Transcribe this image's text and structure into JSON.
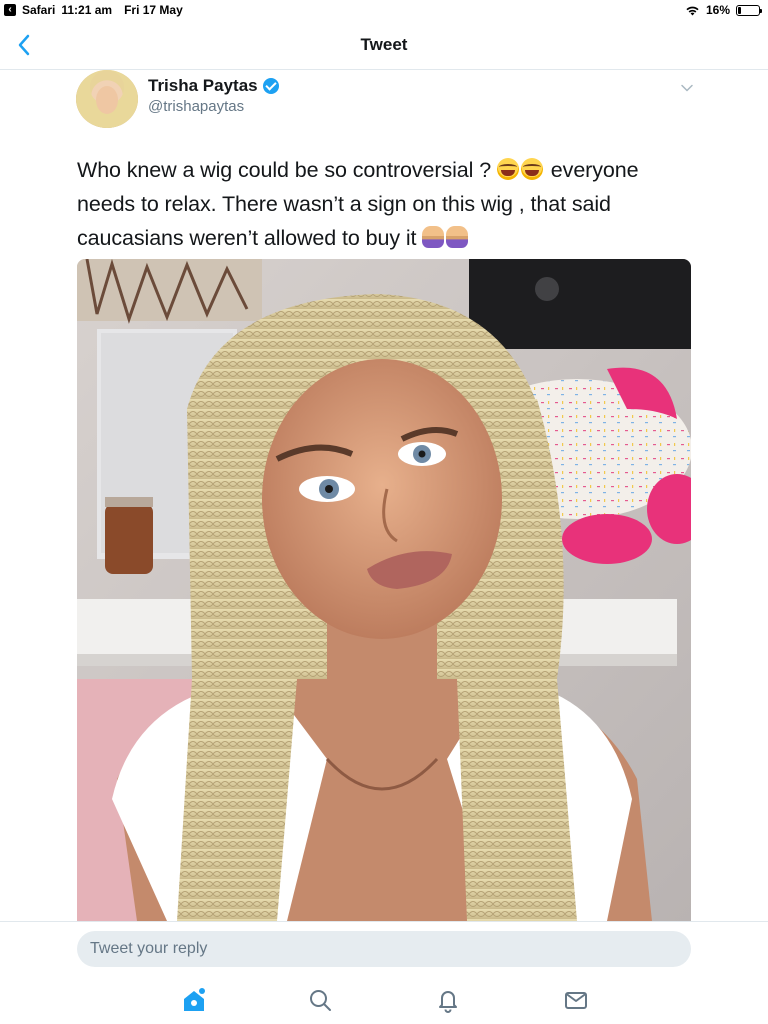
{
  "status_bar": {
    "back_app": "Safari",
    "time": "11:21 am",
    "date": "Fri 17 May",
    "battery_percent": "16%",
    "battery_level": 0.16
  },
  "nav": {
    "title": "Tweet"
  },
  "tweet": {
    "display_name": "Trisha Paytas",
    "verified": true,
    "handle": "@trishapaytas",
    "text_part1": "Who knew a wig could be so controversial ? ",
    "text_part2": " everyone needs to relax. There wasn’t a sign on this wig , that said caucasians weren’t allowed to buy it ",
    "emoji_1": "laughing-crying-emoji",
    "emoji_2": "woman-facepalming-emoji"
  },
  "reply": {
    "placeholder": "Tweet your reply"
  },
  "tab_bar": {
    "items": [
      "home",
      "search",
      "notifications",
      "messages"
    ],
    "active": "home"
  },
  "colors": {
    "accent": "#1da1f2",
    "text": "#14171a",
    "secondary_text": "#657786",
    "divider": "#e1e8ed",
    "input_bg": "#e6ecf0"
  }
}
